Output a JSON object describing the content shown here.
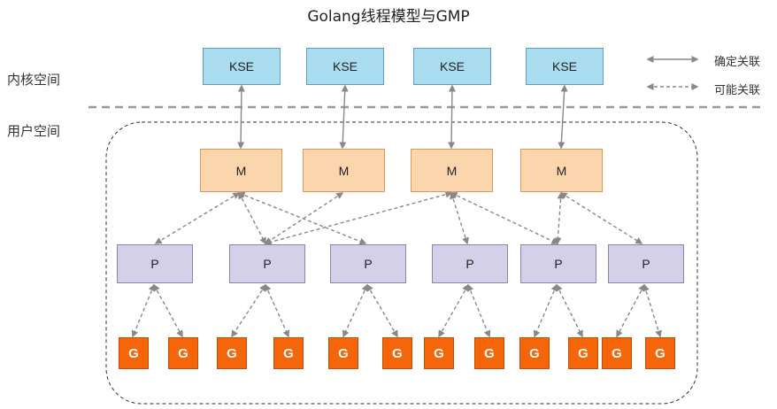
{
  "title": "Golang线程模型与GMP",
  "side_labels": {
    "kernel_space": "内核空间",
    "user_space": "用户空间"
  },
  "legend": {
    "solid": "确定关联",
    "dashed": "可能关联"
  },
  "kse": {
    "label": "KSE",
    "count": 4
  },
  "m": {
    "label": "M",
    "count": 4
  },
  "p": {
    "label": "P",
    "count": 6
  },
  "g": {
    "label": "G",
    "count": 12
  },
  "colors": {
    "kse_fill": "#a8dcee",
    "m_fill": "#fbd6ad",
    "p_fill": "#d3d0e8",
    "g_fill": "#f5650a",
    "connector": "#888888"
  }
}
